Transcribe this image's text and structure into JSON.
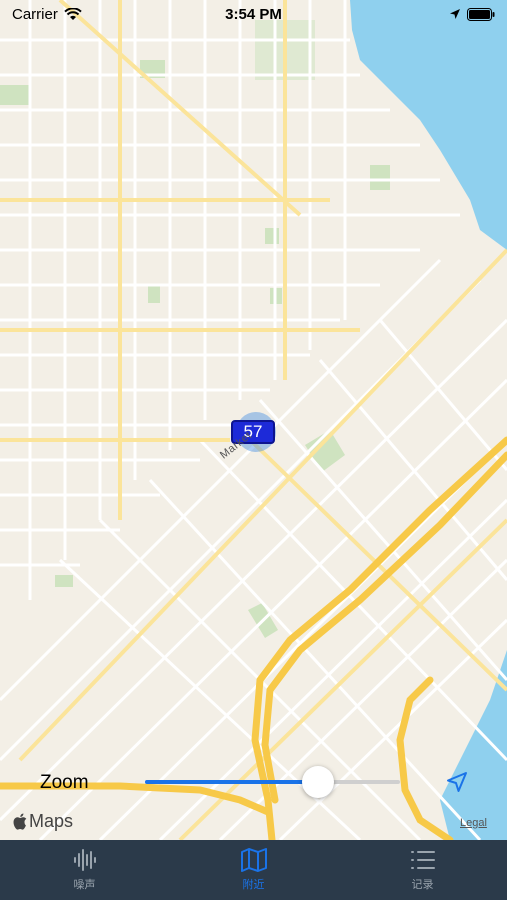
{
  "status_bar": {
    "carrier": "Carrier",
    "time": "3:54 PM"
  },
  "map": {
    "marker_value": "57",
    "street_label": "Market",
    "attribution": "Maps",
    "legal": "Legal"
  },
  "zoom": {
    "label": "Zoom",
    "level": 0.68
  },
  "tabs": [
    {
      "label": "噪声",
      "icon": "waveform-icon",
      "active": false
    },
    {
      "label": "附近",
      "icon": "map-icon",
      "active": true
    },
    {
      "label": "记录",
      "icon": "list-icon",
      "active": false
    }
  ],
  "colors": {
    "accent": "#1a73e8",
    "marker": "#1d2ad8",
    "tabbar_bg": "#2b3a4a",
    "water": "#8fd0ee",
    "highway": "#f7c948"
  }
}
